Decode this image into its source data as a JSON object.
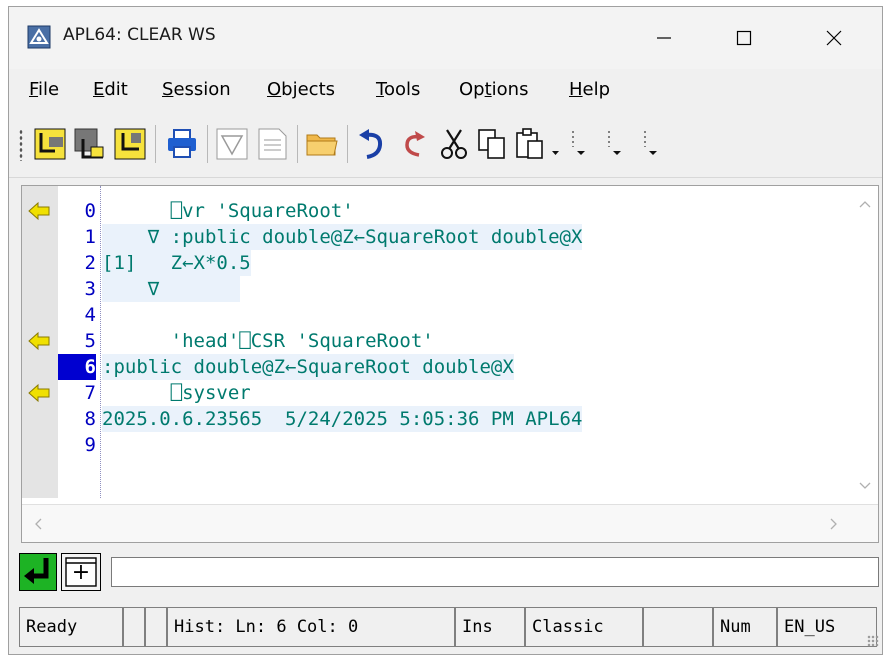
{
  "window": {
    "title": "APL64: CLEAR WS",
    "min_glyph": "—",
    "max_glyph": "☐",
    "close_glyph": "✕"
  },
  "menu": [
    {
      "key": "F",
      "rest": "ile"
    },
    {
      "key": "E",
      "rest": "dit"
    },
    {
      "key": "S",
      "rest": "ession"
    },
    {
      "key": "O",
      "rest": "bjects"
    },
    {
      "key": "T",
      "rest": "ools"
    },
    {
      "pre": "Op",
      "key": "t",
      "rest": "ions"
    },
    {
      "key": "H",
      "rest": "elp"
    }
  ],
  "toolbar": {
    "icons": [
      "indent-icon",
      "outdent-icon",
      "step-icon",
      "print-icon",
      "filter-icon",
      "document-icon",
      "open-folder-icon",
      "undo-icon",
      "redo-icon",
      "cut-icon",
      "copy-icon",
      "paste-icon",
      "dropdown-1",
      "dropdown-2",
      "dropdown-3",
      "dropdown-4"
    ]
  },
  "session": {
    "lines": [
      {
        "num": "0",
        "text": "      ⎕vr 'SquareRoot'",
        "bookmark": true,
        "highlight": false,
        "current": false
      },
      {
        "num": "1",
        "text": "    ∇ :public double@Z←SquareRoot double@X",
        "bookmark": false,
        "highlight": true,
        "current": false
      },
      {
        "num": "2",
        "text": "[1]   Z←X*0.5",
        "bookmark": false,
        "highlight": true,
        "current": false
      },
      {
        "num": "3",
        "text": "    ∇",
        "bookmark": false,
        "highlight": true,
        "current": false
      },
      {
        "num": "4",
        "text": "",
        "bookmark": false,
        "highlight": false,
        "current": false
      },
      {
        "num": "5",
        "text": "      'head'⎕CSR 'SquareRoot'",
        "bookmark": true,
        "highlight": false,
        "current": false
      },
      {
        "num": "6",
        "text": ":public double@Z←SquareRoot double@X",
        "bookmark": false,
        "highlight": true,
        "current": true
      },
      {
        "num": "7",
        "text": "      ⎕sysver",
        "bookmark": true,
        "highlight": false,
        "current": false
      },
      {
        "num": "8",
        "text": "2025.0.6.23565  5/24/2025 5:05:36 PM APL64",
        "bookmark": false,
        "highlight": true,
        "current": false
      },
      {
        "num": "9",
        "text": "",
        "bookmark": false,
        "highlight": false,
        "current": false
      }
    ]
  },
  "input": {
    "value": "",
    "plus_label": "+"
  },
  "status": {
    "ready": "Ready",
    "blank1": "",
    "blank2": "",
    "position": "Hist: Ln: 6 Col: 0",
    "mode": "Ins",
    "style": "Classic",
    "blank3": "",
    "num": "Num",
    "locale": "EN_US"
  },
  "colors": {
    "code_text": "#007a6e",
    "line_number": "#0000c0",
    "current_line_bg": "#0000d0",
    "highlight_bg": "#eaf2fb",
    "bookmark": "#f0e000",
    "enter_button": "#1db324"
  }
}
